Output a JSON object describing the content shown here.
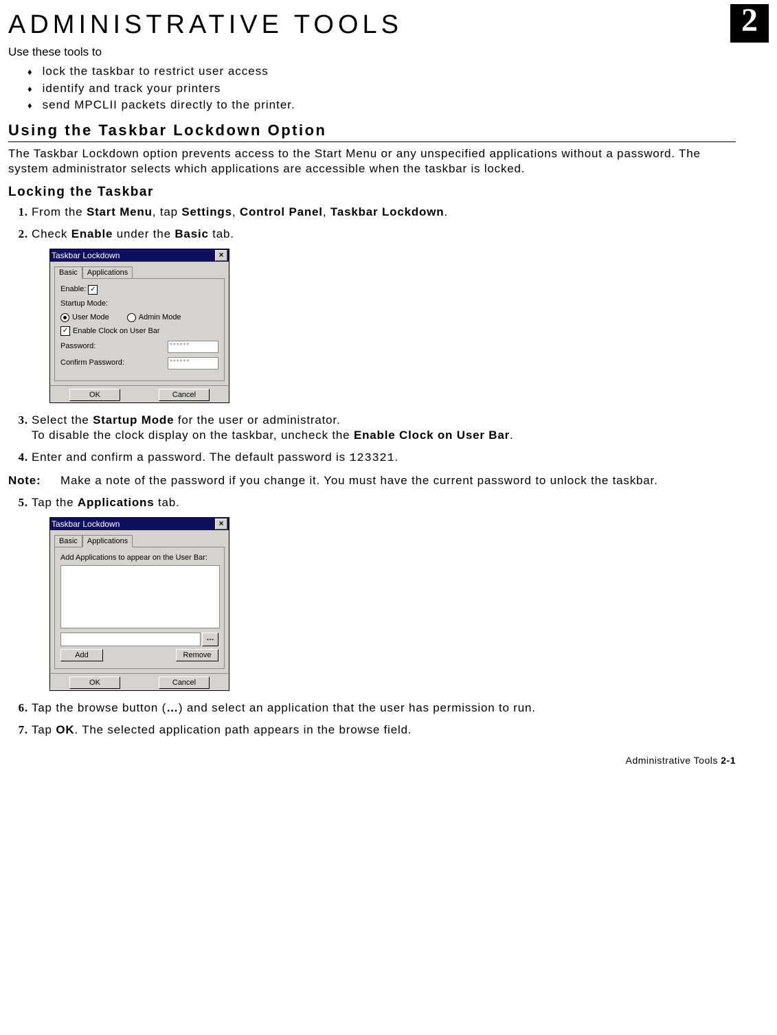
{
  "chapter_number": "2",
  "page_title": "ADMINISTRATIVE TOOLS",
  "intro": "Use these tools to",
  "bullets": [
    "lock the taskbar to restrict user access",
    "identify and track your printers",
    "send MPCLII packets directly to the printer."
  ],
  "section1_heading": "Using the Taskbar Lockdown Option",
  "section1_para": "The Taskbar Lockdown option prevents access to the Start Menu or any unspecified applications without a password.  The system administrator selects which applications are accessible when the taskbar is locked.",
  "subsection_heading": "Locking the Taskbar",
  "step1_pre": "From the ",
  "step1_b1": "Start Menu",
  "step1_mid1": ", tap ",
  "step1_b2": "Settings",
  "step1_mid2": ", ",
  "step1_b3": "Control Panel",
  "step1_mid3": ", ",
  "step1_b4": "Taskbar Lockdown",
  "step1_end": ".",
  "step2_pre": "Check ",
  "step2_b1": "Enable",
  "step2_mid": " under the ",
  "step2_b2": "Basic",
  "step2_end": " tab.",
  "dlg1": {
    "title": "Taskbar Lockdown",
    "tab_basic": "Basic",
    "tab_apps": "Applications",
    "enable_label": "Enable:",
    "startup_label": "Startup Mode:",
    "user_mode": "User Mode",
    "admin_mode": "Admin Mode",
    "clock_label": "Enable Clock on User Bar",
    "password_label": "Password:",
    "confirm_label": "Confirm Password:",
    "masked": "******",
    "ok": "OK",
    "cancel": "Cancel"
  },
  "step3_pre": "Select the ",
  "step3_b1": "Startup Mode",
  "step3_mid": " for the user or administrator.",
  "step3_line2_pre": "To disable the clock display on the taskbar, uncheck the ",
  "step3_line2_b": "Enable Clock on User Bar",
  "step3_line2_end": ".",
  "step4_pre": "Enter and confirm a password.  The default password is ",
  "step4_code": "123321",
  "step4_end": ".",
  "note_label": "Note:",
  "note_text": "Make a note of the password if you change it.  You must have the current password to unlock the taskbar.",
  "step5_pre": "Tap the ",
  "step5_b1": "Applications",
  "step5_end": " tab.",
  "dlg2": {
    "title": "Taskbar Lockdown",
    "tab_basic": "Basic",
    "tab_apps": "Applications",
    "caption": "Add Applications to appear on the User Bar:",
    "browse": "…",
    "add": "Add",
    "remove": "Remove",
    "ok": "OK",
    "cancel": "Cancel"
  },
  "step6_pre": "Tap the browse button (",
  "step6_b1": "…",
  "step6_end": ") and select an application that the user has permission to run.",
  "step7_pre": "Tap ",
  "step7_b1": "OK",
  "step7_end": ". The selected application path appears in the browse field.",
  "footer_text": "Administrative Tools  ",
  "footer_page": "2-1"
}
